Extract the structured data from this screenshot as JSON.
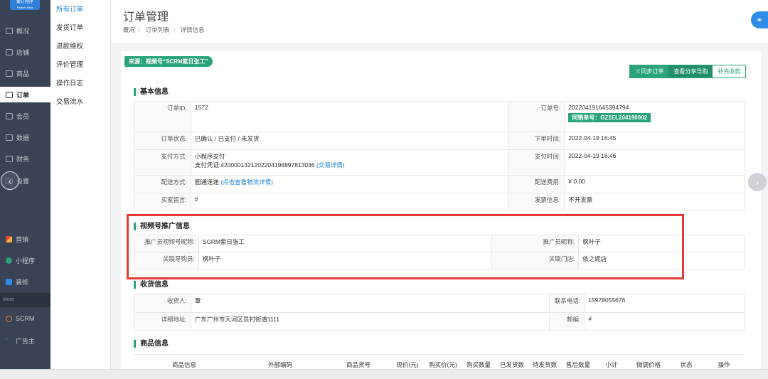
{
  "app": {
    "logo_text": "爱订程序",
    "logo_sub": "Partner Beta"
  },
  "nav": {
    "items": [
      {
        "label": "概况",
        "icon": "monitor-icon"
      },
      {
        "label": "店铺",
        "icon": "store-icon"
      },
      {
        "label": "商品",
        "icon": "bag-icon"
      },
      {
        "label": "订单",
        "icon": "order-icon"
      },
      {
        "label": "会员",
        "icon": "member-icon"
      },
      {
        "label": "数据",
        "icon": "chart-icon"
      },
      {
        "label": "财务",
        "icon": "finance-icon"
      },
      {
        "label": "设置",
        "icon": "settings-icon"
      },
      {
        "label": "营销",
        "icon": "marketing-icon"
      },
      {
        "label": "小程序",
        "icon": "miniprogram-icon"
      },
      {
        "label": "装修",
        "icon": "decorate-icon"
      },
      {
        "label": "SCRM",
        "icon": "scrm-icon"
      },
      {
        "label": "广告主",
        "icon": "advertiser-icon"
      }
    ],
    "more_label": "More",
    "active": "订单"
  },
  "submenu": {
    "items": [
      "所有订单",
      "发货订单",
      "退款维权",
      "评价管理",
      "操作日志",
      "交易流水"
    ],
    "active": "所有订单"
  },
  "header": {
    "title": "订单管理",
    "breadcrumb": [
      "概况",
      "订单列表",
      "详情信息"
    ]
  },
  "detail": {
    "source_tag": "来源：视频号“SCRM紫日张工”",
    "buttons": {
      "sync": "同步订单",
      "share": "查看分享导购",
      "supplement": "补充收款"
    },
    "basic": {
      "title": "基本信息",
      "order_id_label": "订单ID:",
      "order_id": "1572",
      "order_no_label": "订单号:",
      "order_no": "2022041916453947​94",
      "sync_no": "同销单号：GZ1EL204190002",
      "status_label": "订单状态:",
      "status": "已确认 / 已支付 / 未发货",
      "created_label": "下单时间:",
      "created": "2022-04-19 16:45",
      "pay_method_label": "支付方式:",
      "pay_method": "小程序支付",
      "pay_voucher": "支付凭证:4200001321202204198897813036",
      "pay_detail_link": "(交易详情)",
      "pay_time_label": "支付时间:",
      "pay_time": "2022-04-19 16:46",
      "delivery_label": "配送方式:",
      "delivery": "圆通速递",
      "logistics_link": "(点击查看物流详情)",
      "fee_label": "配送费用:",
      "fee": "¥ 0.00",
      "remark_label": "买家留言:",
      "remark": "#",
      "invoice_label": "发票信息:",
      "invoice": "不开发票"
    },
    "promo": {
      "title": "视频号推广信息",
      "promoter_nick_label": "推广员视频号昵称:",
      "promoter_nick": "SCRM紫日张工",
      "promoter_name_label": "推广员昵称:",
      "promoter_name": "枫叶子",
      "guide_label": "关联导购员:",
      "guide": "枫叶子",
      "store_label": "关联门店:",
      "store": "依之妮店"
    },
    "receiver": {
      "title": "收货信息",
      "name_label": "收货人:",
      "name": "覃",
      "phone_label": "联系电话:",
      "phone": "15978055676",
      "address_label": "详细地址:",
      "address": "广东广州市天河区员村街道1111",
      "zip_label": "邮编:",
      "zip": "#"
    },
    "goods": {
      "title": "商品信息",
      "columns": [
        "商品信息",
        "外部编码",
        "商品货号",
        "现价(元)",
        "购买价(元)",
        "购买数量",
        "已发货数",
        "待发货数",
        "售后数量",
        "小计",
        "微调价格",
        "状态",
        "操作"
      ]
    }
  }
}
